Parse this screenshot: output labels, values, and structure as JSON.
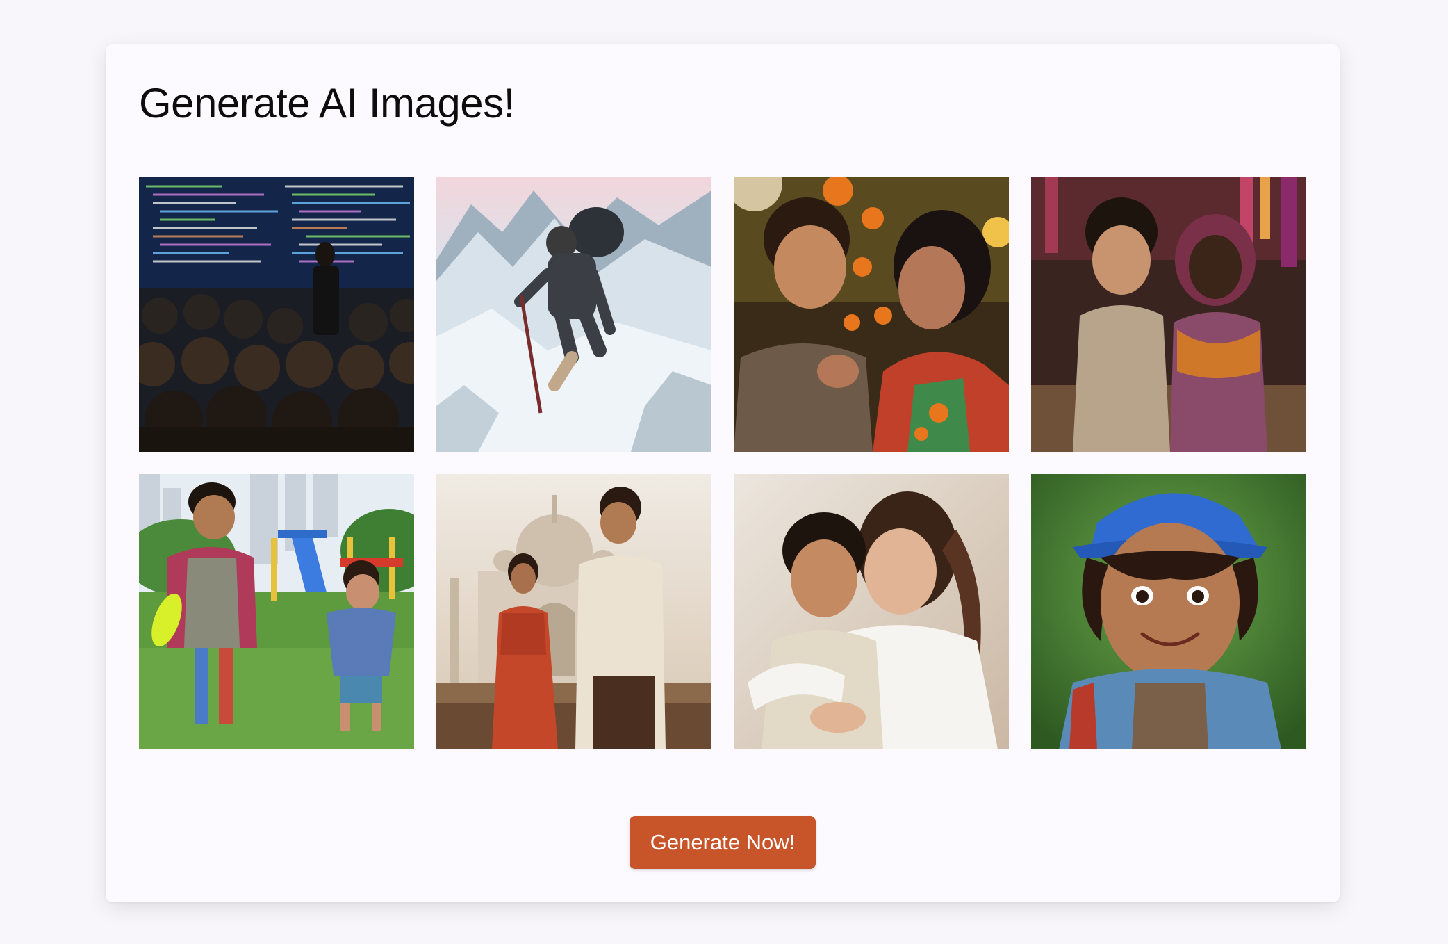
{
  "page": {
    "title": "Generate AI Images!",
    "button_label": "Generate Now!"
  },
  "colors": {
    "background": "#f8f6fb",
    "card": "#fcfaff",
    "button": "#c8552a",
    "button_text": "#ffffff",
    "title_text": "#0d0d0d"
  },
  "images": [
    {
      "id": "img-coding-lecture"
    },
    {
      "id": "img-mountain-climber"
    },
    {
      "id": "img-boy-and-mother-flowers"
    },
    {
      "id": "img-two-children-market"
    },
    {
      "id": "img-kids-playground-frisbee"
    },
    {
      "id": "img-couple-taj-mahal"
    },
    {
      "id": "img-mother-hugging-son"
    },
    {
      "id": "img-boy-blue-cap"
    }
  ]
}
